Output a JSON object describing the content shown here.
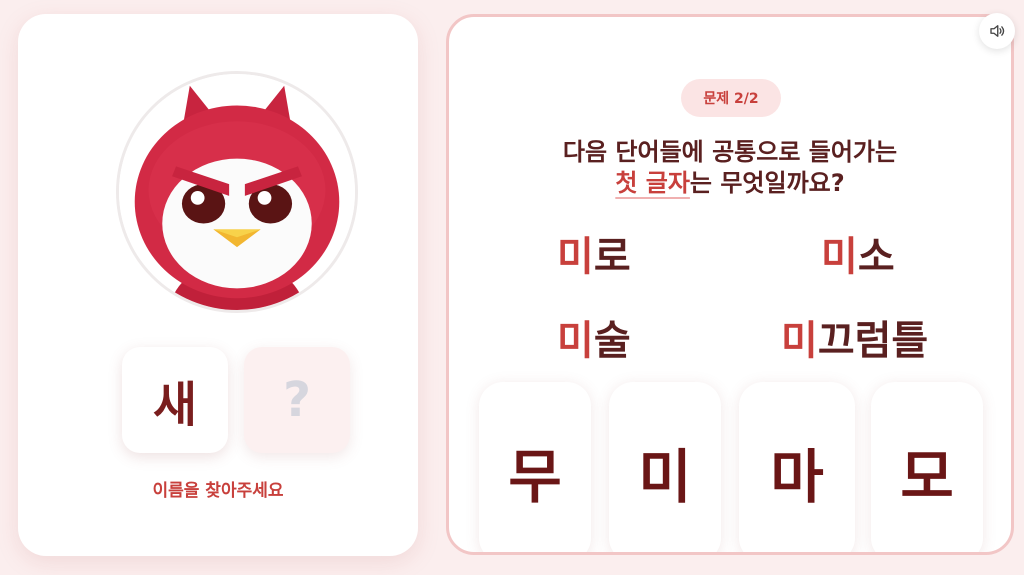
{
  "character": {
    "image_name": "red-owl-mascot",
    "known_letter": "새",
    "unknown_letter": "?",
    "hint": "이름을 찾아주세요"
  },
  "quiz": {
    "badge": "문제 2/2",
    "question_line1": "다음 단어들에 공통으로 들어가는",
    "question_highlight": "첫 글자",
    "question_rest": "는 무엇일까요?",
    "words": [
      {
        "first": "미",
        "rest": "로"
      },
      {
        "first": "미",
        "rest": "소"
      },
      {
        "first": "미",
        "rest": "술"
      },
      {
        "first": "미",
        "rest": "끄럼틀"
      }
    ],
    "options": [
      "무",
      "미",
      "마",
      "모"
    ],
    "sound_icon": "speaker-icon"
  },
  "colors": {
    "accent": "#c8403c",
    "text_dark": "#5a2020",
    "background": "#fbeeee"
  }
}
